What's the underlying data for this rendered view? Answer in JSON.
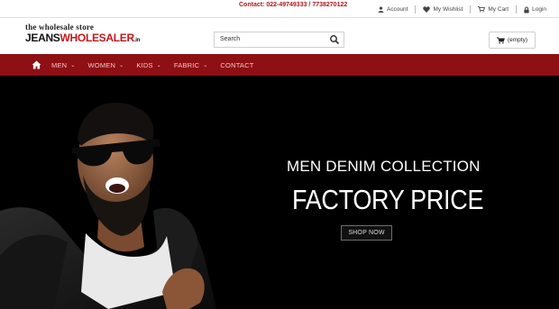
{
  "topbar": {
    "contact": "Contact: 022-49749333 / 7738270122",
    "links": [
      {
        "label": "Account",
        "icon": "user-icon"
      },
      {
        "label": "My Wishlist",
        "icon": "heart-icon"
      },
      {
        "label": "My Cart",
        "icon": "cart-icon"
      },
      {
        "label": "Login",
        "icon": "lock-icon"
      }
    ]
  },
  "logo": {
    "tagline": "the wholesale store",
    "brand_part1": "JEANS",
    "brand_part2": "WHOLESALER",
    "brand_suffix": ".in"
  },
  "search": {
    "placeholder": "Search"
  },
  "cart": {
    "label": "(empty)"
  },
  "nav": {
    "home_icon": "home-icon",
    "items": [
      {
        "label": "MEN",
        "has_dropdown": true
      },
      {
        "label": "WOMEN",
        "has_dropdown": true
      },
      {
        "label": "KIDS",
        "has_dropdown": true
      },
      {
        "label": "FABRIC",
        "has_dropdown": true
      },
      {
        "label": "CONTACT",
        "has_dropdown": false
      }
    ]
  },
  "hero": {
    "subtitle": "MEN DENIM COLLECTION",
    "title": "FACTORY PRICE",
    "button": "SHOP NOW"
  },
  "colors": {
    "brand_red": "#c4181c",
    "nav_bg": "#8e0f14",
    "hero_bg": "#000000"
  }
}
